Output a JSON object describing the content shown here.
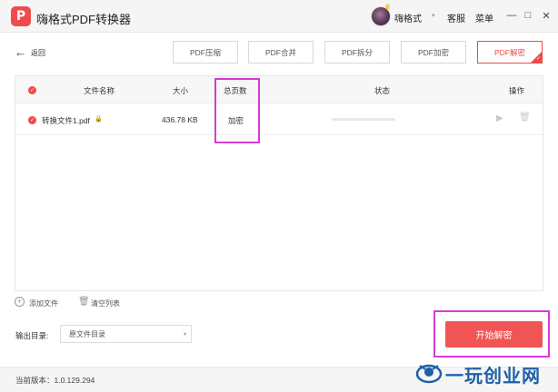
{
  "app": {
    "logo_glyph": "P",
    "title": "嗨格式PDF转换器",
    "user_name": "嗨格式",
    "service_label": "客服",
    "menu_label": "菜单"
  },
  "icons": {
    "back": "←",
    "minimize": "—",
    "maximize": "□",
    "close": "✕",
    "dropdown": "▾",
    "check": "✓",
    "lock": "🔒",
    "play": "▶",
    "trash": "🗑",
    "add": "+"
  },
  "toolbar": {
    "back_label": "返回",
    "tabs": [
      {
        "label": "PDF压缩"
      },
      {
        "label": "PDF合并"
      },
      {
        "label": "PDF拆分"
      },
      {
        "label": "PDF加密"
      },
      {
        "label": "PDF解密"
      }
    ],
    "active_tab": "PDF解密"
  },
  "table": {
    "columns": {
      "name": "文件名称",
      "size": "大小",
      "pages": "总页数",
      "status": "状态",
      "actions": "操作"
    },
    "rows": [
      {
        "name": "转换文件1.pdf",
        "size": "436.78 KB",
        "pages": "加密",
        "progress": 0
      }
    ]
  },
  "bottom": {
    "add_file_label": "添加文件",
    "clear_list_label": "清空列表",
    "output_label": "输出目录:",
    "output_value": "原文件目录",
    "start_label": "开始解密"
  },
  "status": {
    "version": "当前版本：1.0.129.294"
  },
  "watermark": {
    "text": "一玩创业网"
  },
  "colors": {
    "accent": "#ef4b4b",
    "highlight": "#d63ad6",
    "watermark": "#1f5fa8"
  }
}
